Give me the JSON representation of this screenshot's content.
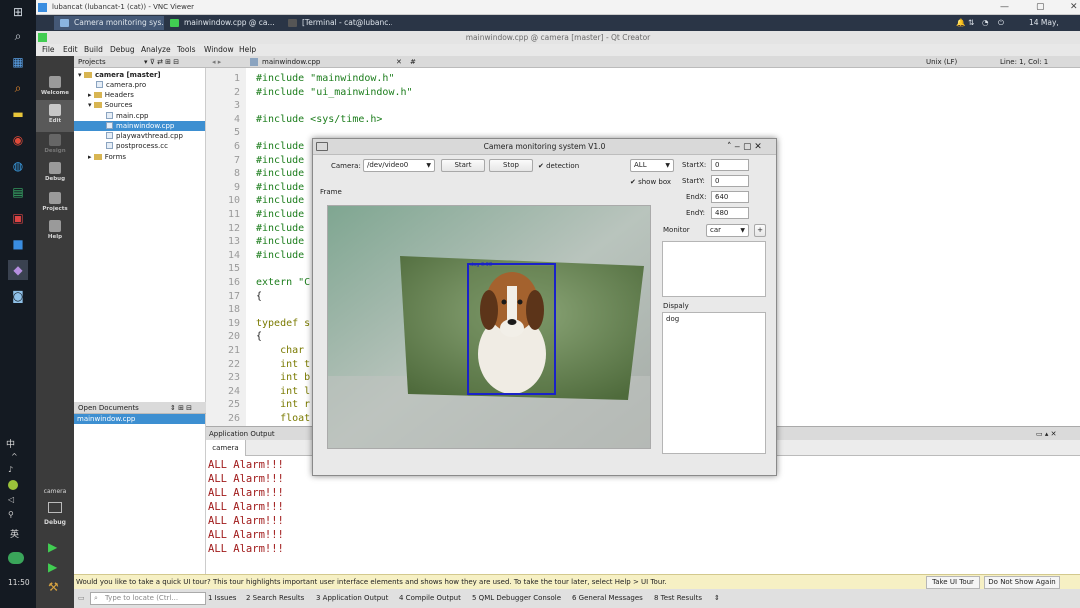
{
  "vnc": {
    "title": "lubancat (lubancat-1 (cat)) - VNC Viewer"
  },
  "taskbar": {
    "tabs": [
      "Camera monitoring sys...",
      "mainwindow.cpp @ ca...",
      "[Terminal - cat@lubanc..."
    ],
    "clock": "14 May, 11:50"
  },
  "win_taskbar": {
    "ime1": "中",
    "ime2": "英",
    "clock": "11:50"
  },
  "qt": {
    "title": "mainwindow.cpp @ camera [master] - Qt Creator",
    "menu": [
      "File",
      "Edit",
      "Build",
      "Debug",
      "Analyze",
      "Tools",
      "Window",
      "Help"
    ],
    "modes": [
      "Welcome",
      "Edit",
      "Design",
      "Debug",
      "Projects",
      "Help"
    ],
    "kit": {
      "project": "camera",
      "mode": "Debug"
    }
  },
  "projects": {
    "header": "Projects",
    "tree": [
      {
        "label": "camera [master]",
        "level": 0,
        "kind": "root"
      },
      {
        "label": "camera.pro",
        "level": 1,
        "kind": "file"
      },
      {
        "label": "Headers",
        "level": 1,
        "kind": "folder"
      },
      {
        "label": "Sources",
        "level": 1,
        "kind": "folder"
      },
      {
        "label": "main.cpp",
        "level": 2,
        "kind": "file"
      },
      {
        "label": "mainwindow.cpp",
        "level": 2,
        "kind": "file",
        "selected": true
      },
      {
        "label": "playwavthread.cpp",
        "level": 2,
        "kind": "file"
      },
      {
        "label": "postprocess.cc",
        "level": 2,
        "kind": "file"
      },
      {
        "label": "Forms",
        "level": 1,
        "kind": "folder"
      }
    ]
  },
  "open_docs": {
    "header": "Open Documents",
    "items": [
      "mainwindow.cpp"
    ]
  },
  "editor": {
    "file": "mainwindow.cpp",
    "symbol": "#",
    "line_ending": "Unix (LF)",
    "position": "Line: 1, Col: 1",
    "lines": [
      {
        "n": "1",
        "text": "#include \"mainwindow.h\"",
        "cls": "pp"
      },
      {
        "n": "2",
        "text": "#include \"ui_mainwindow.h\"",
        "cls": "pp"
      },
      {
        "n": "3",
        "text": "",
        "cls": ""
      },
      {
        "n": "4",
        "text": "#include <sys/time.h>",
        "cls": "pp"
      },
      {
        "n": "5",
        "text": "",
        "cls": ""
      },
      {
        "n": "6",
        "text": "#include",
        "cls": "pp"
      },
      {
        "n": "7",
        "text": "#include",
        "cls": "pp"
      },
      {
        "n": "8",
        "text": "#include",
        "cls": "pp"
      },
      {
        "n": "9",
        "text": "#include",
        "cls": "pp"
      },
      {
        "n": "10",
        "text": "#include",
        "cls": "pp"
      },
      {
        "n": "11",
        "text": "#include",
        "cls": "pp"
      },
      {
        "n": "12",
        "text": "#include",
        "cls": "pp"
      },
      {
        "n": "13",
        "text": "#include",
        "cls": "pp"
      },
      {
        "n": "14",
        "text": "#include",
        "cls": "pp"
      },
      {
        "n": "15",
        "text": "",
        "cls": ""
      },
      {
        "n": "16",
        "text": "extern \"C",
        "cls": "pp"
      },
      {
        "n": "17",
        "text": "{",
        "cls": ""
      },
      {
        "n": "18",
        "text": "",
        "cls": ""
      },
      {
        "n": "19",
        "text": "typedef s",
        "cls": "kw"
      },
      {
        "n": "20",
        "text": "{",
        "cls": ""
      },
      {
        "n": "21",
        "text": "    char",
        "cls": "kw"
      },
      {
        "n": "22",
        "text": "    int t",
        "cls": "kw"
      },
      {
        "n": "23",
        "text": "    int b",
        "cls": "kw"
      },
      {
        "n": "24",
        "text": "    int l",
        "cls": "kw"
      },
      {
        "n": "25",
        "text": "    int r",
        "cls": "kw"
      },
      {
        "n": "26",
        "text": "    float",
        "cls": "kw"
      }
    ]
  },
  "output": {
    "header": "Application Output",
    "tab": "camera",
    "lines": [
      "ALL Alarm!!!",
      "ALL Alarm!!!",
      "ALL Alarm!!!",
      "ALL Alarm!!!",
      "ALL Alarm!!!",
      "ALL Alarm!!!",
      "ALL Alarm!!!"
    ]
  },
  "infobar": {
    "text": "Would you like to take a quick UI tour? This tour highlights important user interface elements and shows how they are used. To take the tour later, select Help > UI Tour.",
    "tour_btn": "Take UI Tour",
    "dismiss_btn": "Do Not Show Again"
  },
  "statusbar": {
    "locate_placeholder": "Type to locate (Ctrl...",
    "panes": [
      "1 Issues",
      "2 Search Results",
      "3 Application Output",
      "4 Compile Output",
      "5 QML Debugger Console",
      "6 General Messages",
      "8 Test Results"
    ]
  },
  "dialog": {
    "title": "Camera monitoring system V1.0",
    "camera_label": "Camera:",
    "camera_device": "/dev/video0",
    "start_btn": "Start",
    "stop_btn": "Stop",
    "detection_label": "detection",
    "detection_checked": true,
    "class_filter": "ALL",
    "show_box_label": "show box",
    "show_box_checked": true,
    "startx_label": "StartX:",
    "startx": "0",
    "starty_label": "StartY:",
    "starty": "0",
    "endx_label": "EndX:",
    "endx": "640",
    "endy_label": "EndY:",
    "endy": "480",
    "frame_label": "Frame",
    "monitor_label": "Monitor",
    "monitor_value": "car",
    "add_btn": "+",
    "display_label": "Dispaly",
    "display_items": [
      "dog"
    ],
    "detection_box_label": "dog 0.98"
  }
}
